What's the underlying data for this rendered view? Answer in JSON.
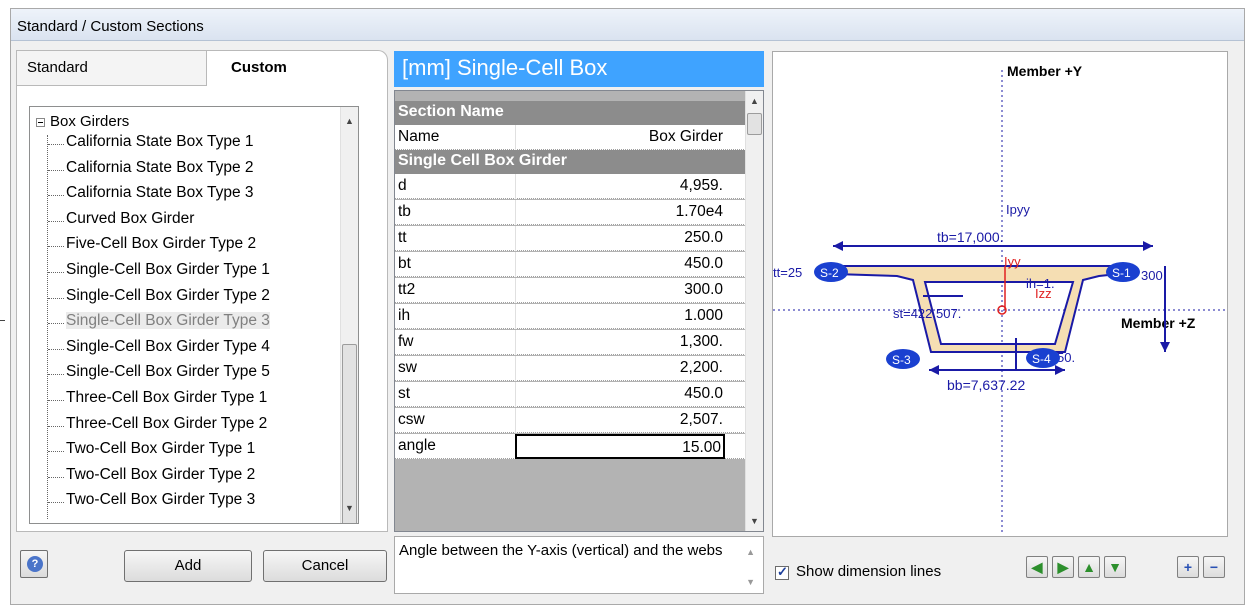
{
  "window": {
    "title": "Standard / Custom Sections"
  },
  "tabs": {
    "standard": "Standard",
    "custom": "Custom"
  },
  "tree": {
    "root": "Box Girders",
    "items": [
      "California State Box Type 1",
      "California State Box Type 2",
      "California State Box Type 3",
      "Curved Box Girder",
      "Five-Cell Box Girder Type 2",
      "Single-Cell Box Girder Type 1",
      "Single-Cell Box Girder Type 2",
      "Single-Cell Box Girder Type 3",
      "Single-Cell Box Girder Type 4",
      "Single-Cell Box Girder Type 5",
      "Three-Cell Box Girder Type 1",
      "Three-Cell Box Girder Type 2",
      "Two-Cell Box Girder Type 1",
      "Two-Cell Box Girder Type 2",
      "Two-Cell Box Girder Type 3"
    ],
    "selected": "Single-Cell Box Girder Type 3"
  },
  "buttons": {
    "add": "Add",
    "cancel": "Cancel"
  },
  "panel": {
    "header": "[mm] Single-Cell Box"
  },
  "grid": {
    "cat1": "Section Name",
    "name_label": "Name",
    "name_value": "Box Girder",
    "cat2": "Single Cell Box Girder",
    "rows": [
      {
        "name": "d",
        "value": "4,959."
      },
      {
        "name": "tb",
        "value": "1.70e4"
      },
      {
        "name": "tt",
        "value": "250.0"
      },
      {
        "name": "bt",
        "value": "450.0"
      },
      {
        "name": "tt2",
        "value": "300.0"
      },
      {
        "name": "ih",
        "value": "1.000"
      },
      {
        "name": "fw",
        "value": "1,300."
      },
      {
        "name": "sw",
        "value": "2,200."
      },
      {
        "name": "st",
        "value": "450.0"
      },
      {
        "name": "csw",
        "value": "2,507."
      },
      {
        "name": "angle",
        "value": "15.00"
      }
    ]
  },
  "description": "Angle between the Y-axis (vertical) and the webs",
  "drawing": {
    "member_y": "Member +Y",
    "member_z": "Member +Z",
    "ipyy": "Ipyy",
    "iyy": "Iyy",
    "izz": "Izz",
    "tb_dim": "tb=17,000.",
    "bb_dim": "bb=7,637.22",
    "tt_dim": "tt=25",
    "ih_dim": "ih=1.",
    "st_dim": "st=422,507.",
    "t300": "300",
    "t50": "50.",
    "s1": "S-1",
    "s2": "S-2",
    "s3": "S-3",
    "s4": "S-4"
  },
  "show_dimension_lines": {
    "label": "Show dimension lines",
    "checked": true
  },
  "colors": {
    "header": "#3fa3ff",
    "section_fill": "#f5deb3",
    "dim_blue": "#1a1aa6",
    "axis_red": "#e02020"
  }
}
